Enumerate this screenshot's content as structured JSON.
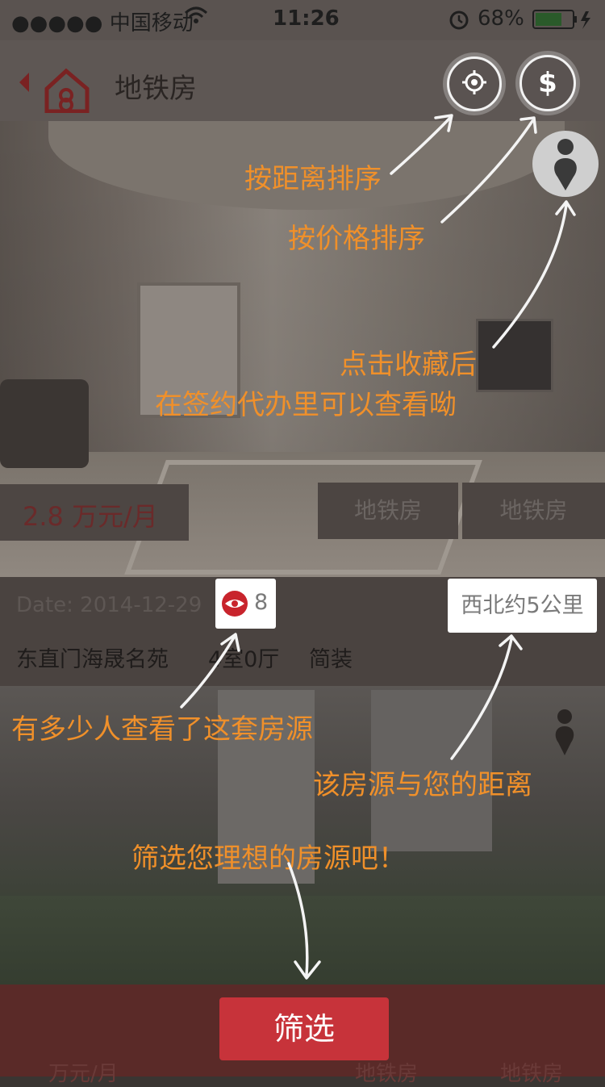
{
  "status_bar": {
    "carrier": "●●●●● 中国移动",
    "time": "11:26",
    "battery": "68%"
  },
  "nav": {
    "title": "地铁房"
  },
  "listing": {
    "price": "2.8 万元/月",
    "tags": [
      "地铁房",
      "地铁房"
    ],
    "date": "Date: 2014-12-29",
    "view_count": "8",
    "title": "东直门海晟名苑",
    "layout": "4室0厅",
    "decoration": "简装",
    "distance": "西北约5公里"
  },
  "bottom_faint": {
    "left": "万元/月",
    "middle": "地铁房",
    "right": "地铁房"
  },
  "hints": {
    "sort_distance": "按距离排序",
    "sort_price": "按价格排序",
    "favorite_line1": "点击收藏后",
    "favorite_line2": "在签约代办里可以查看呦",
    "view_count": "有多少人查看了这套房源",
    "distance": "该房源与您的距离",
    "filter": "筛选您理想的房源吧！"
  },
  "filter_button": {
    "label": "筛选"
  },
  "colors": {
    "hint": "#f0902a",
    "filter_button": "#c7333a",
    "brand_red": "#8a2c2c"
  }
}
